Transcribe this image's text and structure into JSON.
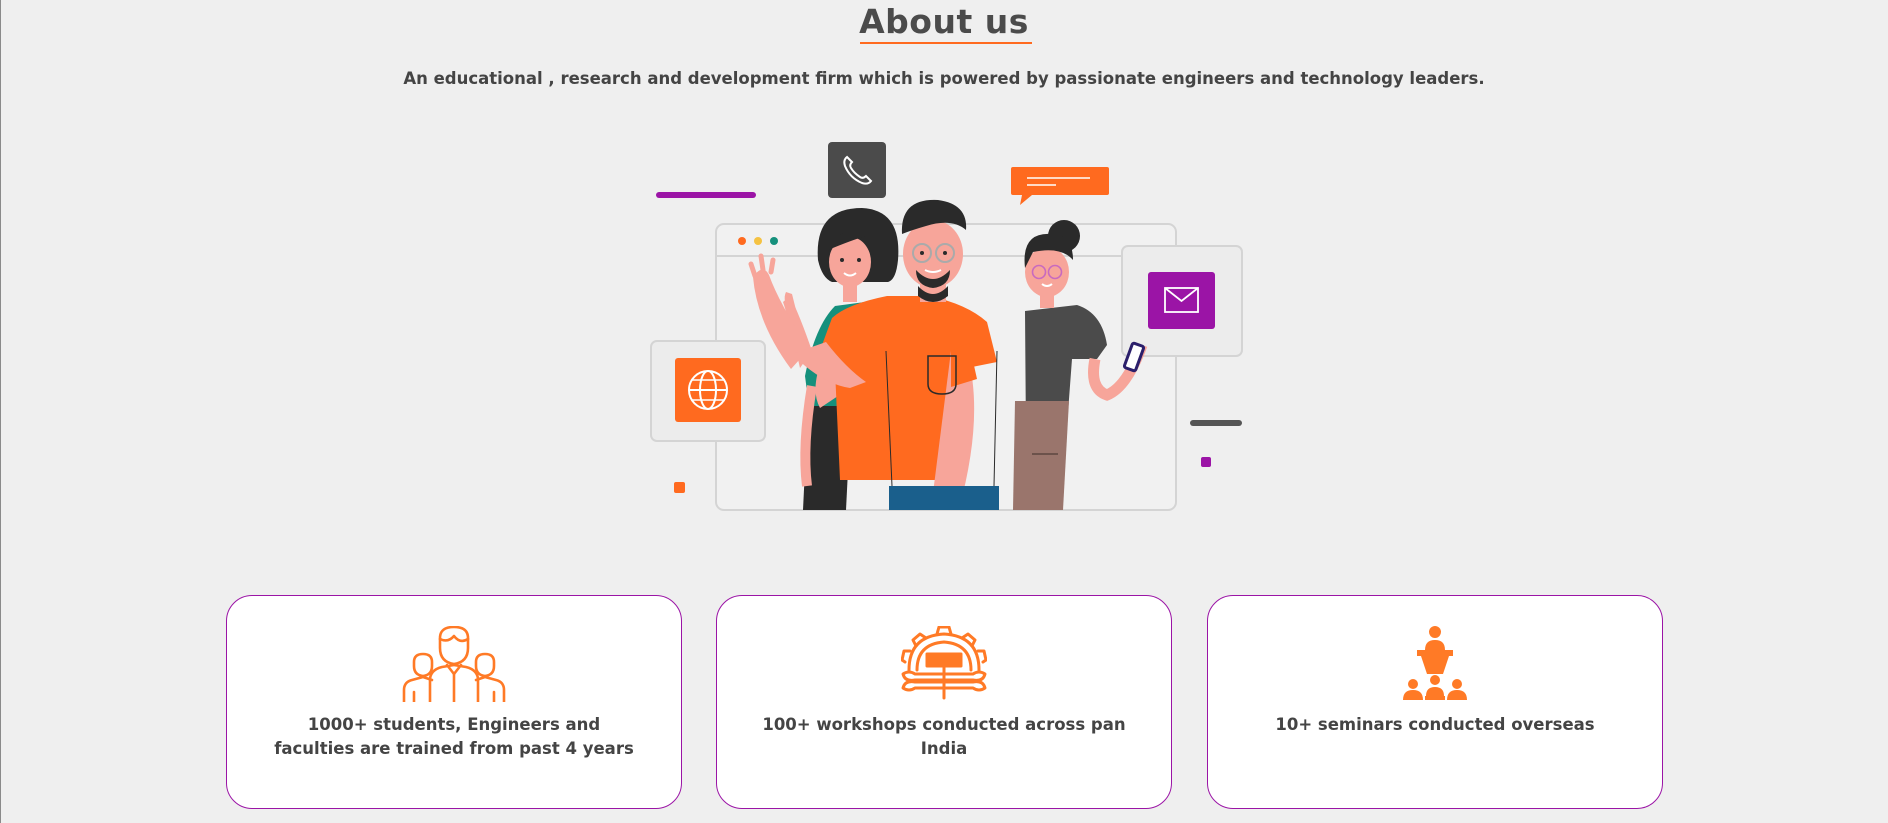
{
  "section": {
    "title": "About us",
    "subtitle": "An educational , research and development firm which is powered by passionate engineers and technology leaders."
  },
  "illustration": {
    "icons": [
      "phone-icon",
      "globe-icon",
      "mail-icon",
      "chat-bubble-icon"
    ]
  },
  "colors": {
    "accent_orange": "#ff6a1f",
    "accent_purple": "#9b14a6",
    "dark_grey": "#4b4b4b",
    "background": "#efefef"
  },
  "stats": [
    {
      "icon": "people-group-icon",
      "text": "1000+ students, Engineers and faculties are trained from past 4 years"
    },
    {
      "icon": "gear-tools-icon",
      "text": "100+ workshops conducted across pan India"
    },
    {
      "icon": "presenter-audience-icon",
      "text": "10+ seminars conducted overseas"
    }
  ]
}
